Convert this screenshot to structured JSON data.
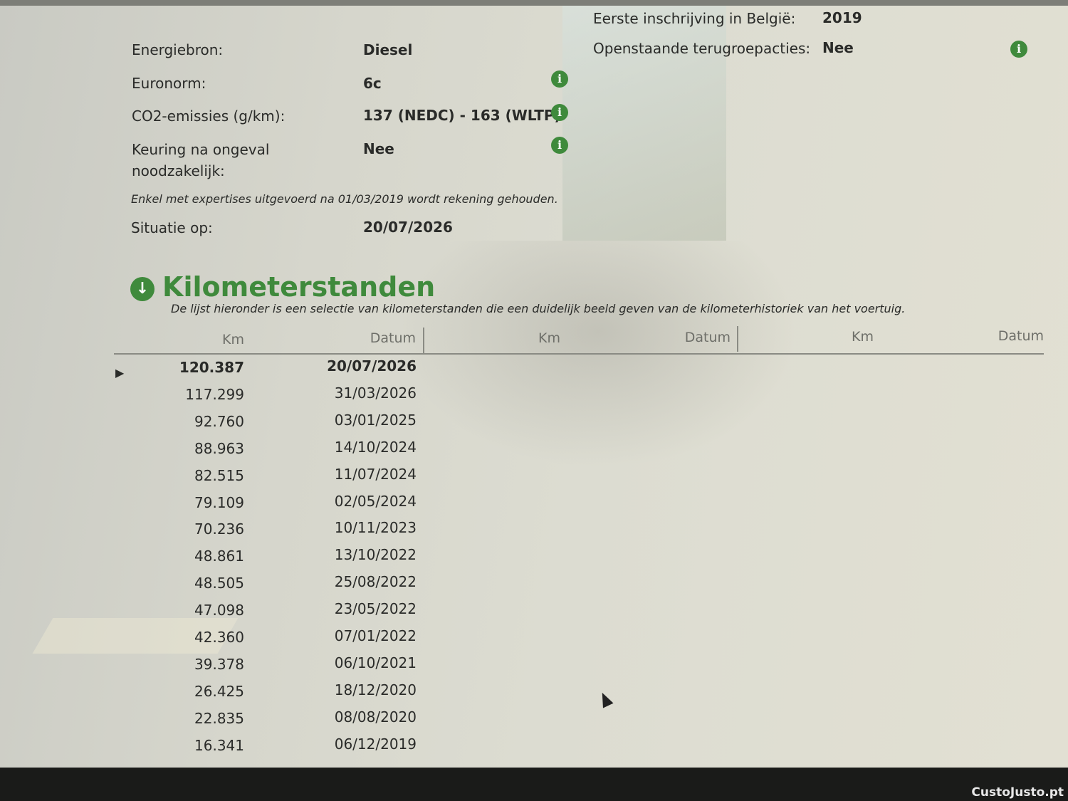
{
  "details_left": [
    {
      "label": "Energiebron:",
      "value": "Diesel",
      "info": false
    },
    {
      "label": "Euronorm:",
      "value": "6c",
      "info": true
    },
    {
      "label": "CO2-emissies (g/km):",
      "value": "137 (NEDC) - 163 (WLTP)",
      "info": true
    },
    {
      "label": "Keuring na ongeval",
      "label2": "noodzakelijk:",
      "value": "Nee",
      "info": true
    }
  ],
  "details_right": [
    {
      "label": "Eerste inschrijving in België:",
      "value": "2019"
    },
    {
      "label": "Openstaande terugroepacties:",
      "value": "Nee"
    }
  ],
  "note": "Enkel met expertises uitgevoerd na 01/03/2019 wordt rekening gehouden.",
  "situatie": {
    "label": "Situatie op:",
    "value": "20/07/2026"
  },
  "section": {
    "title": "Kilometerstanden",
    "subtitle": "De lijst hieronder is een selectie van kilometerstanden die een duidelijk beeld geven van de kilometerhistoriek van het voertuig."
  },
  "table": {
    "headers": [
      "Km",
      "Datum",
      "Km",
      "Datum",
      "Km",
      "Datum"
    ],
    "rows": [
      {
        "km": "120.387",
        "datum": "20/07/2026"
      },
      {
        "km": "117.299",
        "datum": "31/03/2026"
      },
      {
        "km": "92.760",
        "datum": "03/01/2025"
      },
      {
        "km": "88.963",
        "datum": "14/10/2024"
      },
      {
        "km": "82.515",
        "datum": "11/07/2024"
      },
      {
        "km": "79.109",
        "datum": "02/05/2024"
      },
      {
        "km": "70.236",
        "datum": "10/11/2023"
      },
      {
        "km": "48.861",
        "datum": "13/10/2022"
      },
      {
        "km": "48.505",
        "datum": "25/08/2022"
      },
      {
        "km": "47.098",
        "datum": "23/05/2022"
      },
      {
        "km": "42.360",
        "datum": "07/01/2022"
      },
      {
        "km": "39.378",
        "datum": "06/10/2021"
      },
      {
        "km": "26.425",
        "datum": "18/12/2020"
      },
      {
        "km": "22.835",
        "datum": "08/08/2020"
      },
      {
        "km": "16.341",
        "datum": "06/12/2019"
      }
    ]
  },
  "icons": {
    "info": "info-icon",
    "section": "arrow-down-circle-icon",
    "row_marker": "triangle-right-icon"
  },
  "colors": {
    "accent": "#3f8a3c"
  },
  "watermark": "CustoJusto.pt"
}
